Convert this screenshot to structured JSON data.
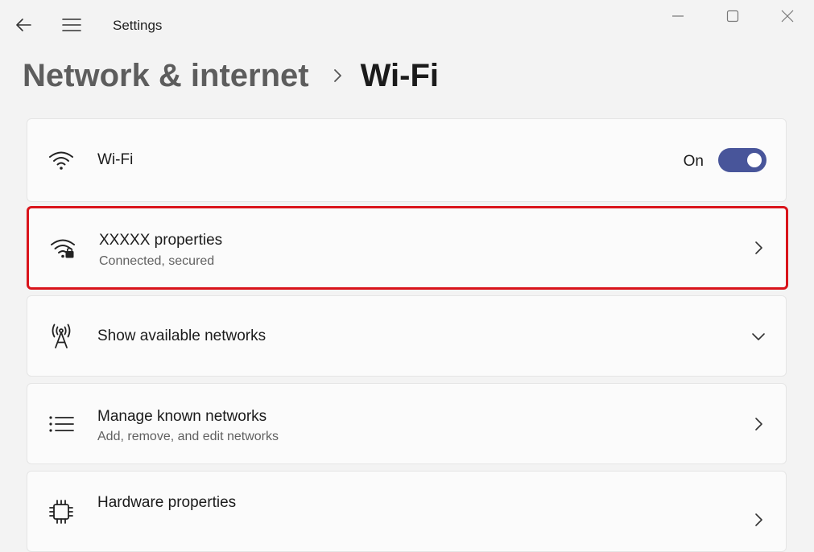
{
  "window": {
    "app_title": "Settings"
  },
  "breadcrumb": {
    "parent": "Network & internet",
    "current": "Wi-Fi"
  },
  "wifi_toggle": {
    "label": "Wi-Fi",
    "state_label": "On",
    "enabled": true,
    "accent_color": "#48559a"
  },
  "network_properties": {
    "title": "XXXXX properties",
    "subtitle": "Connected, secured",
    "highlight_color": "#d9141b"
  },
  "available_networks": {
    "title": "Show available networks"
  },
  "known_networks": {
    "title": "Manage known networks",
    "subtitle": "Add, remove, and edit networks"
  },
  "hardware": {
    "title": "Hardware properties"
  },
  "icons": {
    "back": "back-arrow-icon",
    "menu": "hamburger-menu-icon",
    "wifi": "wifi-icon",
    "wifi_secured": "wifi-lock-icon",
    "antenna": "antenna-tower-icon",
    "list": "list-icon",
    "chip": "chip-icon",
    "chevron_right": "chevron-right-icon",
    "chevron_down": "chevron-down-icon"
  }
}
